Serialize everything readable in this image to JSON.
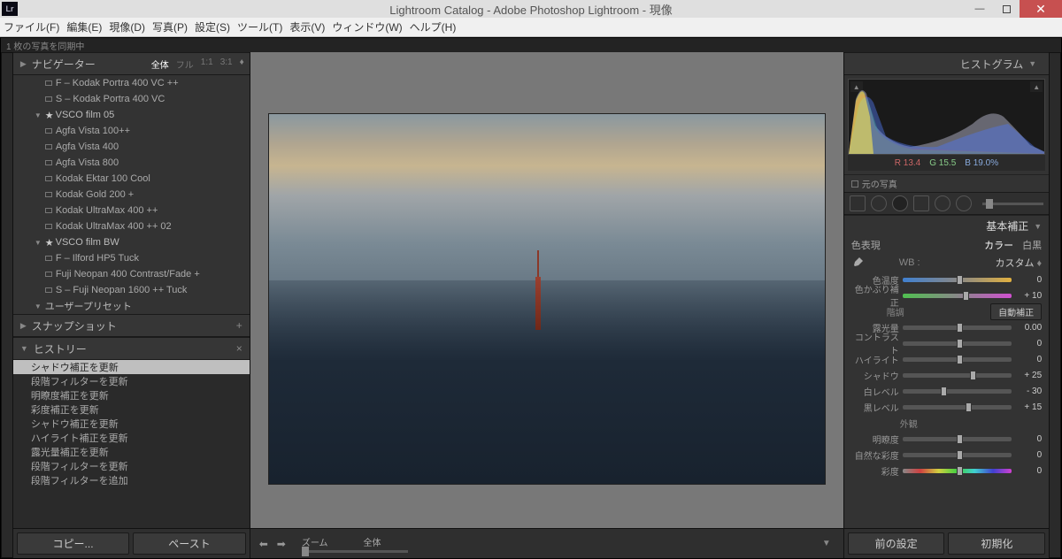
{
  "title": "Lightroom Catalog - Adobe Photoshop Lightroom - 現像",
  "menu": [
    "ファイル(F)",
    "編集(E)",
    "現像(D)",
    "写真(P)",
    "設定(S)",
    "ツール(T)",
    "表示(V)",
    "ウィンドウ(W)",
    "ヘルプ(H)"
  ],
  "status": "1 枚の写真を同期中",
  "navigator": {
    "label": "ナビゲーター",
    "opts": [
      "全体",
      "フル",
      "1:1",
      "3:1"
    ],
    "active": 0
  },
  "presets": {
    "items": [
      {
        "type": "preset",
        "label": "F – Kodak Portra 400 VC ++"
      },
      {
        "type": "preset",
        "label": "S – Kodak Portra 400 VC"
      },
      {
        "type": "folder",
        "label": "VSCO  film 05",
        "star": true
      },
      {
        "type": "preset",
        "label": "Agfa Vista 100++"
      },
      {
        "type": "preset",
        "label": "Agfa Vista 400"
      },
      {
        "type": "preset",
        "label": "Agfa Vista 800"
      },
      {
        "type": "preset",
        "label": "Kodak Ektar 100 Cool"
      },
      {
        "type": "preset",
        "label": "Kodak Gold 200 +"
      },
      {
        "type": "preset",
        "label": "Kodak UltraMax 400 ++"
      },
      {
        "type": "preset",
        "label": "Kodak UltraMax 400 ++ 02"
      },
      {
        "type": "folder",
        "label": "VSCO  film BW",
        "star": true
      },
      {
        "type": "preset",
        "label": "F – Ilford HP5 Tuck"
      },
      {
        "type": "preset",
        "label": "Fuji Neopan 400 Contrast/Fade +"
      },
      {
        "type": "preset",
        "label": "S – Fuji Neopan 1600 ++ Tuck"
      },
      {
        "type": "folder",
        "label": "ユーザープリセット",
        "star": false
      }
    ]
  },
  "snapshots": {
    "label": "スナップショット"
  },
  "history": {
    "label": "ヒストリー",
    "items": [
      "シャドウ補正を更新",
      "段階フィルターを更新",
      "明瞭度補正を更新",
      "彩度補正を更新",
      "シャドウ補正を更新",
      "ハイライト補正を更新",
      "露光量補正を更新",
      "段階フィルターを更新",
      "段階フィルターを追加"
    ],
    "active": 0
  },
  "leftButtons": {
    "copy": "コピー...",
    "paste": "ペースト"
  },
  "zoom": {
    "label": "ズーム",
    "fit": "全体"
  },
  "histogram": {
    "label": "ヒストグラム",
    "rgb": {
      "r": "R  13.4",
      "g": "G  15.5",
      "b": "B  19.0%"
    },
    "original": "元の写真"
  },
  "basic": {
    "label": "基本補正",
    "treatment": {
      "label": "色表現",
      "opts": [
        "カラー",
        "白黒"
      ],
      "active": 0
    },
    "wb": {
      "label": "WB :",
      "mode": "カスタム",
      "temp_label": "色温度",
      "temp_val": "0",
      "tint_label": "色かぶり補正",
      "tint_val": "+ 10"
    },
    "tone": {
      "label": "階調",
      "auto": "自動補正",
      "sliders": [
        {
          "label": "露光量",
          "val": "0.00",
          "pos": 50
        },
        {
          "label": "コントラスト",
          "val": "0",
          "pos": 50
        },
        {
          "label": "ハイライト",
          "val": "0",
          "pos": 50
        },
        {
          "label": "シャドウ",
          "val": "+ 25",
          "pos": 62
        },
        {
          "label": "白レベル",
          "val": "- 30",
          "pos": 35
        },
        {
          "label": "黒レベル",
          "val": "+ 15",
          "pos": 58
        }
      ]
    },
    "presence": {
      "label": "外観",
      "sliders": [
        {
          "label": "明瞭度",
          "val": "0",
          "pos": 50
        },
        {
          "label": "自然な彩度",
          "val": "0",
          "pos": 50
        },
        {
          "label": "彩度",
          "val": "0",
          "pos": 50,
          "sat": true
        }
      ]
    }
  },
  "rightButtons": {
    "prev": "前の設定",
    "reset": "初期化"
  }
}
